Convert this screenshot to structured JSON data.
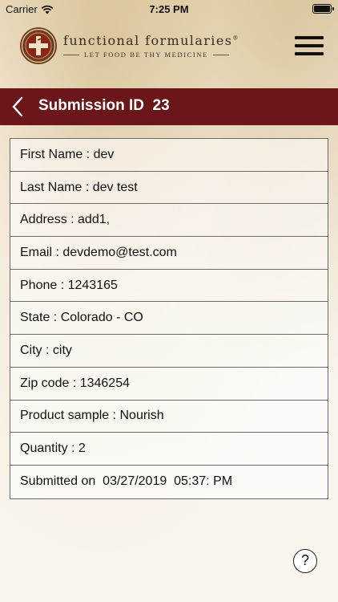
{
  "status_bar": {
    "carrier": "Carrier",
    "time": "7:25 PM",
    "icons": [
      "wifi-icon",
      "battery-icon"
    ]
  },
  "header": {
    "brand_name": "functional formularies",
    "trademark": "®",
    "tagline": "LET FOOD BE THY MEDICINE",
    "menu_icon": "hamburger-menu-icon"
  },
  "title_bar": {
    "title": "Submission ID  23",
    "back_icon": "chevron-left-icon",
    "background_color": "#6b1619"
  },
  "details": [
    "First Name : dev",
    "Last Name : dev test",
    "Address : add1,",
    "Email : devdemo@test.com",
    "Phone : 1243165",
    "State : Colorado - CO",
    "City : city",
    "Zip code : 1346254",
    "Product sample : Nourish",
    "Quantity : 2",
    "Submitted on  03/27/2019  05:37: PM"
  ],
  "help_button": {
    "label": "?"
  }
}
